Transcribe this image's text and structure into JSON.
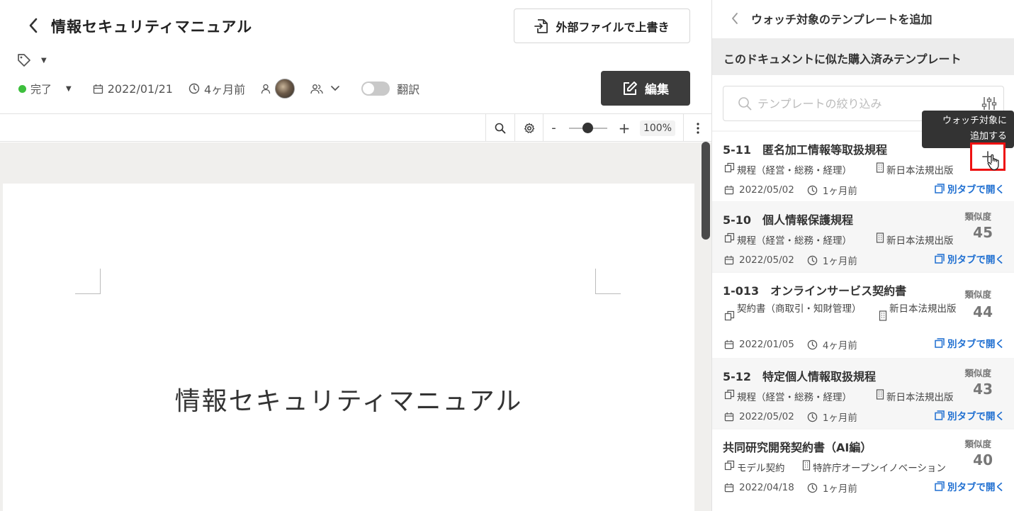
{
  "document": {
    "title": "情報セキュリティマニュアル",
    "overwrite_button": "外部ファイルで上書き",
    "status": "完了",
    "date": "2022/01/21",
    "updated": "4ヶ月前",
    "translate_label": "翻訳",
    "edit_button": "編集",
    "zoom": "100%",
    "page_title": "情報セキュリティマニュアル",
    "status_color": "#3dbf3d"
  },
  "panel": {
    "header_title": "ウォッチ対象のテンプレートを追加",
    "section_title": "このドキュメントに似た購入済みテンプレート",
    "search_placeholder": "テンプレートの絞り込み",
    "tooltip": [
      "ウォッチ対象に",
      "追加する"
    ],
    "open_tab_label": "別タブで開く",
    "similarity_label": "類似度",
    "link_color": "#1f6fd1",
    "templates": [
      {
        "title": "5-11　匿名加工情報等取扱規程",
        "category": "規程（経営・総務・経理）",
        "publisher": "新日本法規出版",
        "date": "2022/05/02",
        "ago": "1ヶ月前",
        "similarity": ""
      },
      {
        "title": "5-10　個人情報保護規程",
        "category": "規程（経営・総務・経理）",
        "publisher": "新日本法規出版",
        "date": "2022/05/02",
        "ago": "1ヶ月前",
        "similarity": "45"
      },
      {
        "title": "1-013　オンラインサービス契約書",
        "category": "契約書（商取引・知財管理）",
        "publisher": "新日本法規出版",
        "date": "2022/01/05",
        "ago": "4ヶ月前",
        "similarity": "44"
      },
      {
        "title": "5-12　特定個人情報取扱規程",
        "category": "規程（経営・総務・経理）",
        "publisher": "新日本法規出版",
        "date": "2022/05/02",
        "ago": "1ヶ月前",
        "similarity": "43"
      },
      {
        "title": "共同研究開発契約書（AI編）",
        "category": "モデル契約",
        "publisher": "特許庁オープンイノベーション",
        "date": "2022/04/18",
        "ago": "1ヶ月前",
        "similarity": "40"
      }
    ]
  }
}
